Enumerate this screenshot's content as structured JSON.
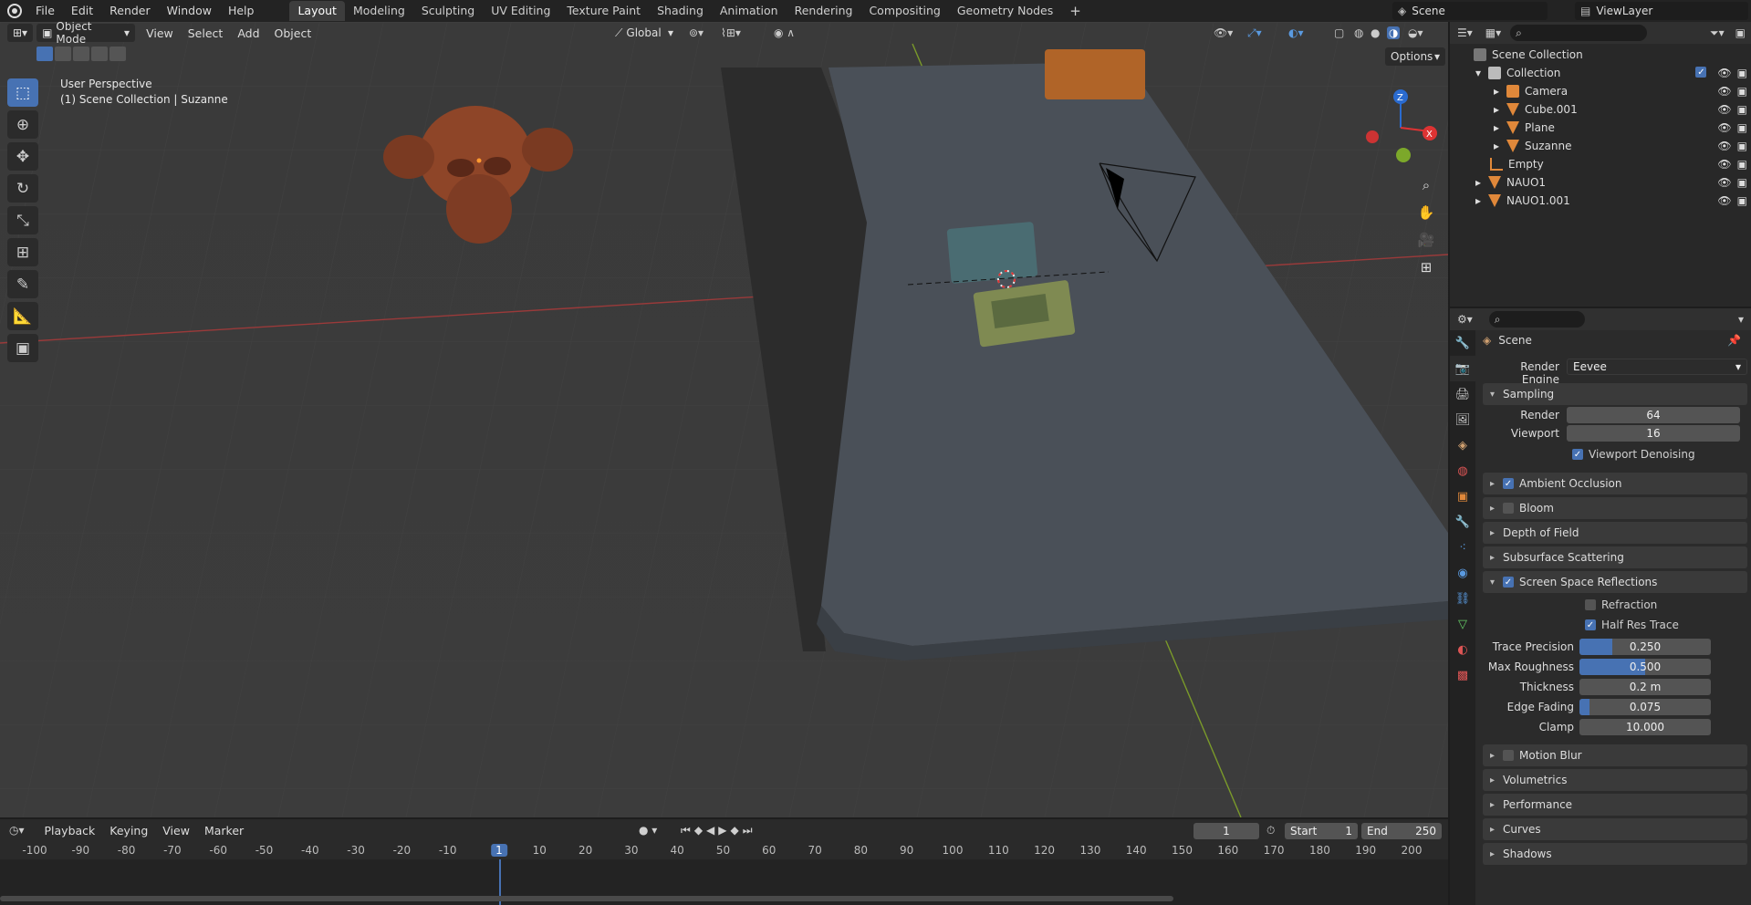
{
  "menubar": {
    "items": [
      "File",
      "Edit",
      "Render",
      "Window",
      "Help"
    ]
  },
  "workspaces": [
    "Layout",
    "Modeling",
    "Sculpting",
    "UV Editing",
    "Texture Paint",
    "Shading",
    "Animation",
    "Rendering",
    "Compositing",
    "Geometry Nodes"
  ],
  "active_workspace": "Layout",
  "scene_name": "Scene",
  "view_layer": "ViewLayer",
  "viewport": {
    "mode": "Object Mode",
    "menus": [
      "View",
      "Select",
      "Add",
      "Object"
    ],
    "transform_orientation": "Global",
    "options_label": "Options",
    "perspective_label": "User Perspective",
    "collection_label": "(1) Scene Collection | Suzanne",
    "axes": {
      "x": "X",
      "y": "Y",
      "z": "Z"
    }
  },
  "tools": [
    "select-box",
    "cursor",
    "move",
    "rotate",
    "scale",
    "transform",
    "annotate",
    "measure",
    "add-cube"
  ],
  "outliner": {
    "root": "Scene Collection",
    "rows": [
      {
        "name": "Collection",
        "level": 1
      },
      {
        "name": "Camera",
        "level": 2
      },
      {
        "name": "Cube.001",
        "level": 2
      },
      {
        "name": "Plane",
        "level": 2
      },
      {
        "name": "Suzanne",
        "level": 2
      },
      {
        "name": "Empty",
        "level": 1
      },
      {
        "name": "NAUO1",
        "level": 1
      },
      {
        "name": "NAUO1.001",
        "level": 1
      }
    ]
  },
  "properties": {
    "context": "Scene",
    "render_engine_label": "Render Engine",
    "render_engine": "Eevee",
    "sampling": {
      "title": "Sampling",
      "render_label": "Render",
      "render": "64",
      "viewport_label": "Viewport",
      "viewport": "16",
      "denoise_label": "Viewport Denoising"
    },
    "panels": {
      "ao": "Ambient Occlusion",
      "bloom": "Bloom",
      "dof": "Depth of Field",
      "sss": "Subsurface Scattering",
      "ssr": "Screen Space Reflections",
      "motion_blur": "Motion Blur",
      "volumetrics": "Volumetrics",
      "performance": "Performance",
      "curves": "Curves",
      "shadows": "Shadows"
    },
    "ssr": {
      "refraction": "Refraction",
      "half_res": "Half Res Trace",
      "trace_precision_label": "Trace Precision",
      "trace_precision": "0.250",
      "trace_precision_frac": 0.25,
      "max_roughness_label": "Max Roughness",
      "max_roughness": "0.500",
      "max_roughness_frac": 0.5,
      "thickness_label": "Thickness",
      "thickness": "0.2 m",
      "edge_fading_label": "Edge Fading",
      "edge_fading": "0.075",
      "edge_fading_frac": 0.075,
      "clamp_label": "Clamp",
      "clamp": "10.000"
    }
  },
  "timeline": {
    "menus": [
      "Playback",
      "Keying",
      "View",
      "Marker"
    ],
    "current_frame": "1",
    "start_label": "Start",
    "start": "1",
    "end_label": "End",
    "end": "250",
    "ruler": [
      "-100",
      "-90",
      "-80",
      "-70",
      "-60",
      "-50",
      "-40",
      "-30",
      "-20",
      "-10",
      "1",
      "10",
      "20",
      "30",
      "40",
      "50",
      "60",
      "70",
      "80",
      "90",
      "100",
      "110",
      "120",
      "130",
      "140",
      "150",
      "160",
      "170",
      "180",
      "190",
      "200"
    ]
  }
}
